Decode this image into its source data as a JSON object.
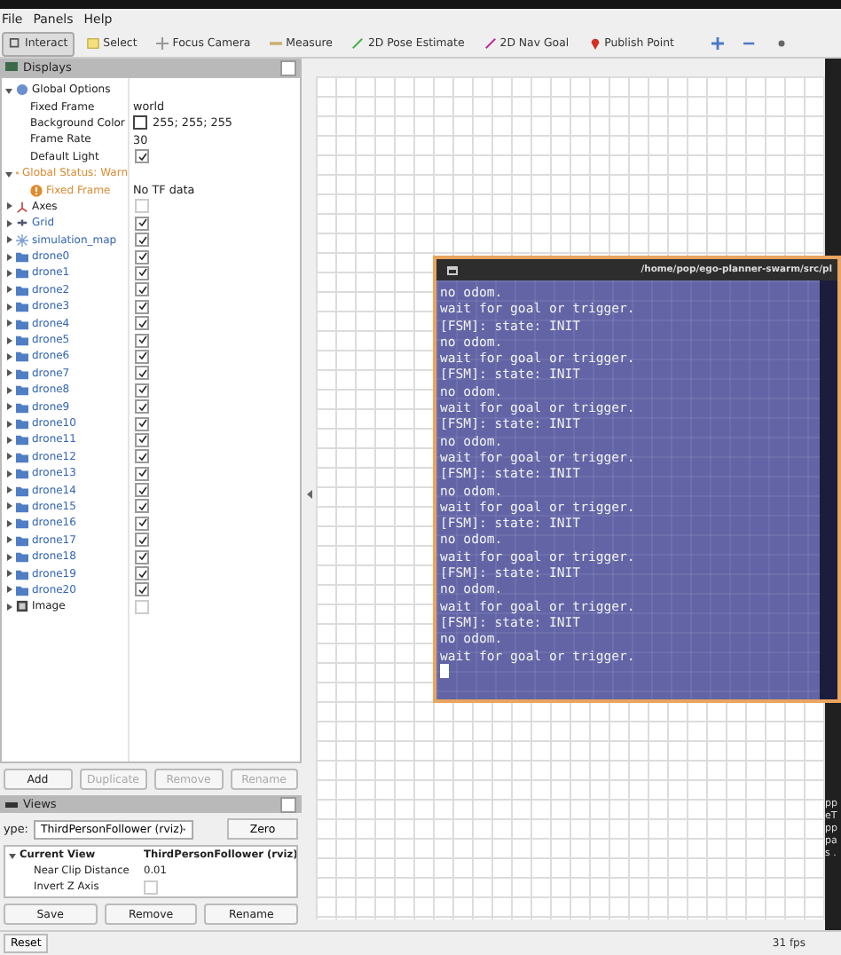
{
  "menu": [
    "File",
    "Panels",
    "Help"
  ],
  "toolbar": [
    {
      "label": "Interact",
      "kind": "interact",
      "selected": true
    },
    {
      "label": "Select",
      "kind": "select",
      "selected": false
    },
    {
      "label": "Focus Camera",
      "kind": "focus",
      "selected": false
    },
    {
      "label": "Measure",
      "kind": "measure",
      "selected": false
    },
    {
      "label": "2D Pose Estimate",
      "kind": "pose",
      "selected": false
    },
    {
      "label": "2D Nav Goal",
      "kind": "goal",
      "selected": false
    },
    {
      "label": "Publish Point",
      "kind": "point",
      "selected": false
    },
    {
      "kind": "move",
      "selected": false
    },
    {
      "kind": "minus",
      "selected": false
    },
    {
      "kind": "dot",
      "selected": false
    }
  ],
  "displays": {
    "title": "Displays",
    "tree": [
      {
        "label": "Global Options",
        "kind": "options",
        "expanded": true,
        "children": [
          {
            "label": "Fixed Frame",
            "kind": "property",
            "value": "world"
          },
          {
            "label": "Background Color",
            "kind": "color-property",
            "value": "255; 255; 255"
          },
          {
            "label": "Frame Rate",
            "kind": "property",
            "value": "30"
          },
          {
            "label": "Default Light",
            "kind": "bool-property",
            "checked": true
          }
        ]
      },
      {
        "label": "Global Status: Warn",
        "kind": "status",
        "expanded": true,
        "children": [
          {
            "label": "Fixed Frame",
            "kind": "status",
            "value": "No TF data"
          }
        ]
      },
      {
        "label": "Axes",
        "kind": "axes",
        "expanded": false,
        "checked": false
      },
      {
        "label": "Grid",
        "kind": "grid",
        "expanded": false,
        "checked": true
      },
      {
        "label": "simulation_map",
        "kind": "map",
        "expanded": false,
        "checked": true
      },
      {
        "label": "drone0",
        "kind": "folder",
        "expanded": false,
        "checked": true
      },
      {
        "label": "drone1",
        "kind": "folder",
        "expanded": false,
        "checked": true
      },
      {
        "label": "drone2",
        "kind": "folder",
        "expanded": false,
        "checked": true
      },
      {
        "label": "drone3",
        "kind": "folder",
        "expanded": false,
        "checked": true
      },
      {
        "label": "drone4",
        "kind": "folder",
        "expanded": false,
        "checked": true
      },
      {
        "label": "drone5",
        "kind": "folder",
        "expanded": false,
        "checked": true
      },
      {
        "label": "drone6",
        "kind": "folder",
        "expanded": false,
        "checked": true
      },
      {
        "label": "drone7",
        "kind": "folder",
        "expanded": false,
        "checked": true
      },
      {
        "label": "drone8",
        "kind": "folder",
        "expanded": false,
        "checked": true
      },
      {
        "label": "drone9",
        "kind": "folder",
        "expanded": false,
        "checked": true
      },
      {
        "label": "drone10",
        "kind": "folder",
        "expanded": false,
        "checked": true
      },
      {
        "label": "drone11",
        "kind": "folder",
        "expanded": false,
        "checked": true
      },
      {
        "label": "drone12",
        "kind": "folder",
        "expanded": false,
        "checked": true
      },
      {
        "label": "drone13",
        "kind": "folder",
        "expanded": false,
        "checked": true
      },
      {
        "label": "drone14",
        "kind": "folder",
        "expanded": false,
        "checked": true
      },
      {
        "label": "drone15",
        "kind": "folder",
        "expanded": false,
        "checked": true
      },
      {
        "label": "drone16",
        "kind": "folder",
        "expanded": false,
        "checked": true
      },
      {
        "label": "drone17",
        "kind": "folder",
        "expanded": false,
        "checked": true
      },
      {
        "label": "drone18",
        "kind": "folder",
        "expanded": false,
        "checked": true
      },
      {
        "label": "drone19",
        "kind": "folder",
        "expanded": false,
        "checked": true
      },
      {
        "label": "drone20",
        "kind": "folder",
        "expanded": false,
        "checked": true
      },
      {
        "label": "Image",
        "kind": "image",
        "expanded": false,
        "checked": false
      }
    ],
    "buttons": [
      {
        "label": "Add",
        "disabled": false
      },
      {
        "label": "Duplicate",
        "disabled": true
      },
      {
        "label": "Remove",
        "disabled": true
      },
      {
        "label": "Rename",
        "disabled": true
      }
    ]
  },
  "views": {
    "title": "Views",
    "type_label": "ype:",
    "type_value": "ThirdPersonFollower (rviz)",
    "zero": "Zero",
    "rows": [
      {
        "label": "Current View",
        "kind": "header",
        "value": "ThirdPersonFollower (rviz)",
        "expanded": true
      },
      {
        "label": "Near Clip Distance",
        "kind": "property",
        "value": "0.01"
      },
      {
        "label": "Invert Z Axis",
        "kind": "bool-property",
        "checked": false
      }
    ],
    "buttons": [
      "Save",
      "Remove",
      "Rename"
    ]
  },
  "status_bar": {
    "reset": "Reset",
    "fps": "31 fps"
  },
  "terminal": {
    "title": "/home/pop/ego-planner-swarm/src/pl",
    "lines": [
      "no odom.",
      "wait for goal or trigger.",
      "[FSM]: state: INIT",
      "no odom.",
      "wait for goal or trigger.",
      "[FSM]: state: INIT",
      "no odom.",
      "wait for goal or trigger.",
      "[FSM]: state: INIT",
      "no odom.",
      "wait for goal or trigger.",
      "[FSM]: state: INIT",
      "no odom.",
      "wait for goal or trigger.",
      "[FSM]: state: INIT",
      "no odom.",
      "wait for goal or trigger.",
      "[FSM]: state: INIT",
      "no odom.",
      "wait for goal or trigger.",
      "[FSM]: state: INIT",
      "no odom.",
      "wait for goal or trigger."
    ]
  },
  "side_fragments": [
    "pp",
    "eT",
    "pp",
    "pa",
    "s ."
  ]
}
